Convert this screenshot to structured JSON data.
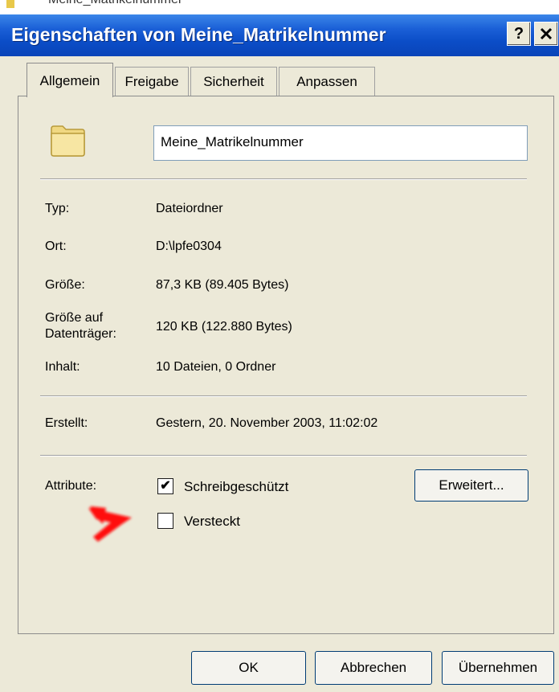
{
  "background_window": {
    "title_fragment": "Meine_Matrikelnummer"
  },
  "titlebar": {
    "title": "Eigenschaften von Meine_Matrikelnummer",
    "help_label": "?",
    "close_label": "✕",
    "color": "#0a4ac2"
  },
  "tabs": [
    {
      "label": "Allgemein",
      "active": true
    },
    {
      "label": "Freigabe",
      "active": false
    },
    {
      "label": "Sicherheit",
      "active": false
    },
    {
      "label": "Anpassen",
      "active": false
    }
  ],
  "general": {
    "folder_icon": "folder-icon",
    "name_value": "Meine_Matrikelnummer",
    "type_label": "Typ:",
    "type_value": "Dateiordner",
    "location_label": "Ort:",
    "location_value": "D:\\lpfe0304",
    "size_label": "Größe:",
    "size_value": "87,3 KB (89.405 Bytes)",
    "size_on_disk_label_1": "Größe auf",
    "size_on_disk_label_2": "Datenträger:",
    "size_on_disk_value": "120 KB (122.880 Bytes)",
    "contents_label": "Inhalt:",
    "contents_value": "10 Dateien, 0 Ordner",
    "created_label": "Erstellt:",
    "created_value": "Gestern, 20. November 2003, 11:02:02",
    "attributes_label": "Attribute:",
    "readonly_label": "Schreibgeschützt",
    "readonly_checked": true,
    "readonly_mark": "✔",
    "hidden_label": "Versteckt",
    "hidden_checked": false,
    "advanced_button": "Erweitert..."
  },
  "footer": {
    "ok": "OK",
    "cancel": "Abbrechen",
    "apply": "Übernehmen"
  },
  "annotation": {
    "arrow_color": "#ff0000",
    "icon": "red-arrow-icon"
  }
}
